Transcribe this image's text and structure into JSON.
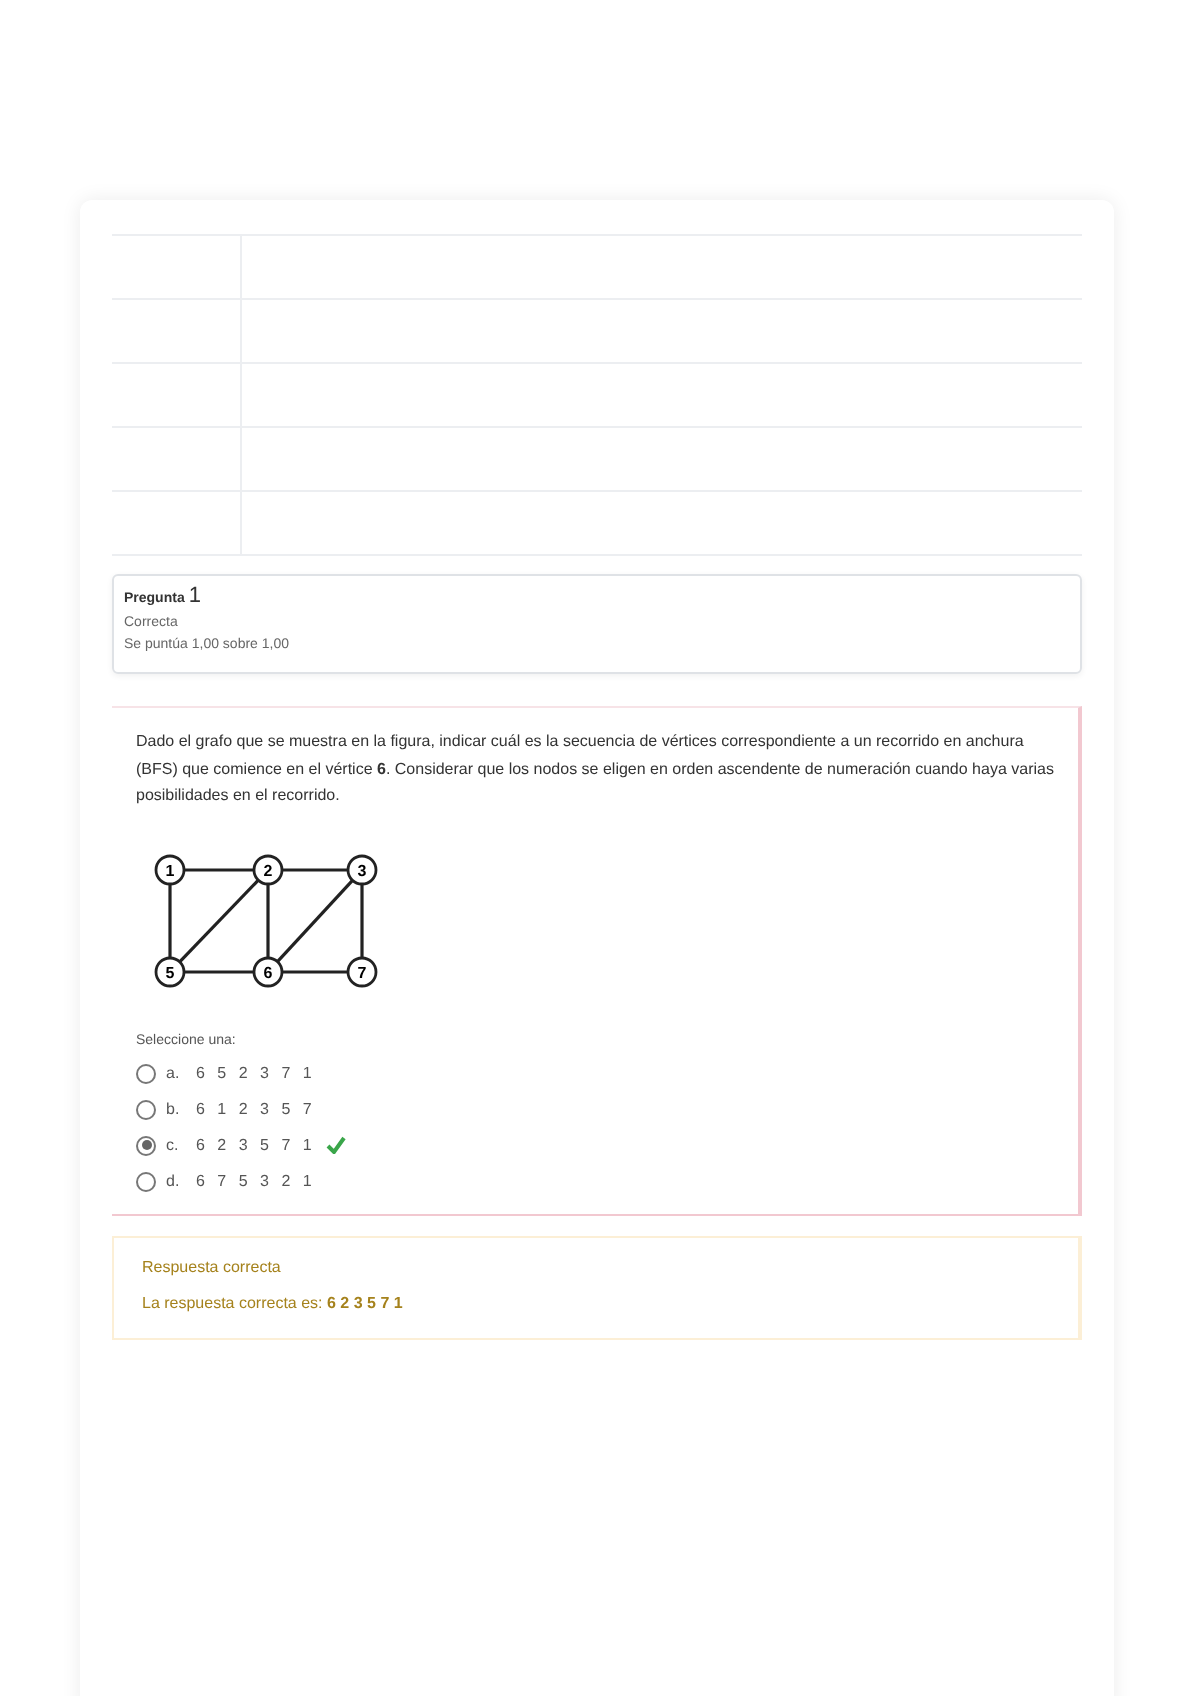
{
  "question_info": {
    "label": "Pregunta",
    "number": "1",
    "status": "Correcta",
    "grade": "Se puntúa 1,00 sobre 1,00"
  },
  "question": {
    "text": "Dado el grafo que se muestra en la figura, indicar cuál es la secuencia de vértices correspondiente a un recorrido en anchura (BFS) que comience en el vértice **6**. Considerar que los nodos se eligen en orden ascendente de numeración cuando haya varias posibilidades en el recorrido.",
    "graph": {
      "nodes": [
        "1",
        "2",
        "3",
        "5",
        "6",
        "7"
      ]
    },
    "prompt": "Seleccione una:",
    "options": [
      {
        "letter": "a.",
        "text": "6 5 2 3 7 1",
        "selected": false,
        "correct": false
      },
      {
        "letter": "b.",
        "text": "6 1 2 3 5 7",
        "selected": false,
        "correct": false
      },
      {
        "letter": "c.",
        "text": "6 2 3 5 7 1",
        "selected": true,
        "correct": true
      },
      {
        "letter": "d.",
        "text": "6 7 5 3 2 1",
        "selected": false,
        "correct": false
      }
    ]
  },
  "feedback": {
    "title": "Respuesta correcta",
    "text": "La respuesta correcta es: **6 2 3 5 7 1**"
  }
}
